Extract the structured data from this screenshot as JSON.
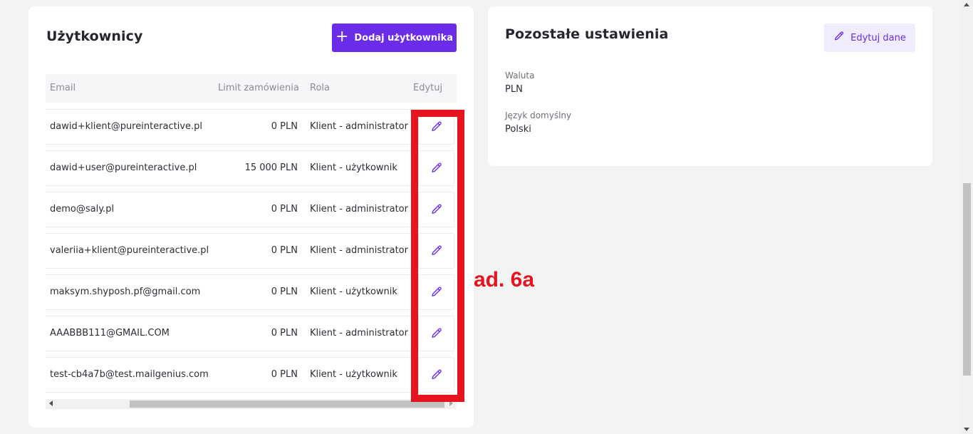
{
  "users": {
    "title": "Użytkownicy",
    "add_button_label": "Dodaj użytkownika",
    "columns": {
      "email": "Email",
      "limit": "Limit zamówienia",
      "role": "Rola",
      "edit": "Edytuj"
    },
    "rows": [
      {
        "email": "dawid+klient@pureinteractive.pl",
        "limit": "0 PLN",
        "role": "Klient - administrator"
      },
      {
        "email": "dawid+user@pureinteractive.pl",
        "limit": "15 000 PLN",
        "role": "Klient - użytkownik"
      },
      {
        "email": "demo@saly.pl",
        "limit": "0 PLN",
        "role": "Klient - administrator"
      },
      {
        "email": "valeriia+klient@pureinteractive.pl",
        "limit": "0 PLN",
        "role": "Klient - administrator"
      },
      {
        "email": "maksym.shyposh.pf@gmail.com",
        "limit": "0 PLN",
        "role": "Klient - użytkownik"
      },
      {
        "email": "AAABBB111@GMAIL.COM",
        "limit": "0 PLN",
        "role": "Klient - administrator"
      },
      {
        "email": "test-cb4a7b@test.mailgenius.com",
        "limit": "0 PLN",
        "role": "Klient - użytkownik"
      }
    ]
  },
  "settings": {
    "title": "Pozostałe ustawienia",
    "edit_button_label": "Edytuj dane",
    "currency_label": "Waluta",
    "currency_value": "PLN",
    "language_label": "Język domyślny",
    "language_value": "Polski"
  },
  "annotation": {
    "text": "ad. 6a"
  },
  "icons": {
    "add": "plus-icon",
    "edit": "pencil-icon"
  },
  "colors": {
    "accent": "#6a2ce8",
    "accent_light": "#f0ebfd",
    "annotation": "#e5141e",
    "background": "#f2f3f5"
  }
}
